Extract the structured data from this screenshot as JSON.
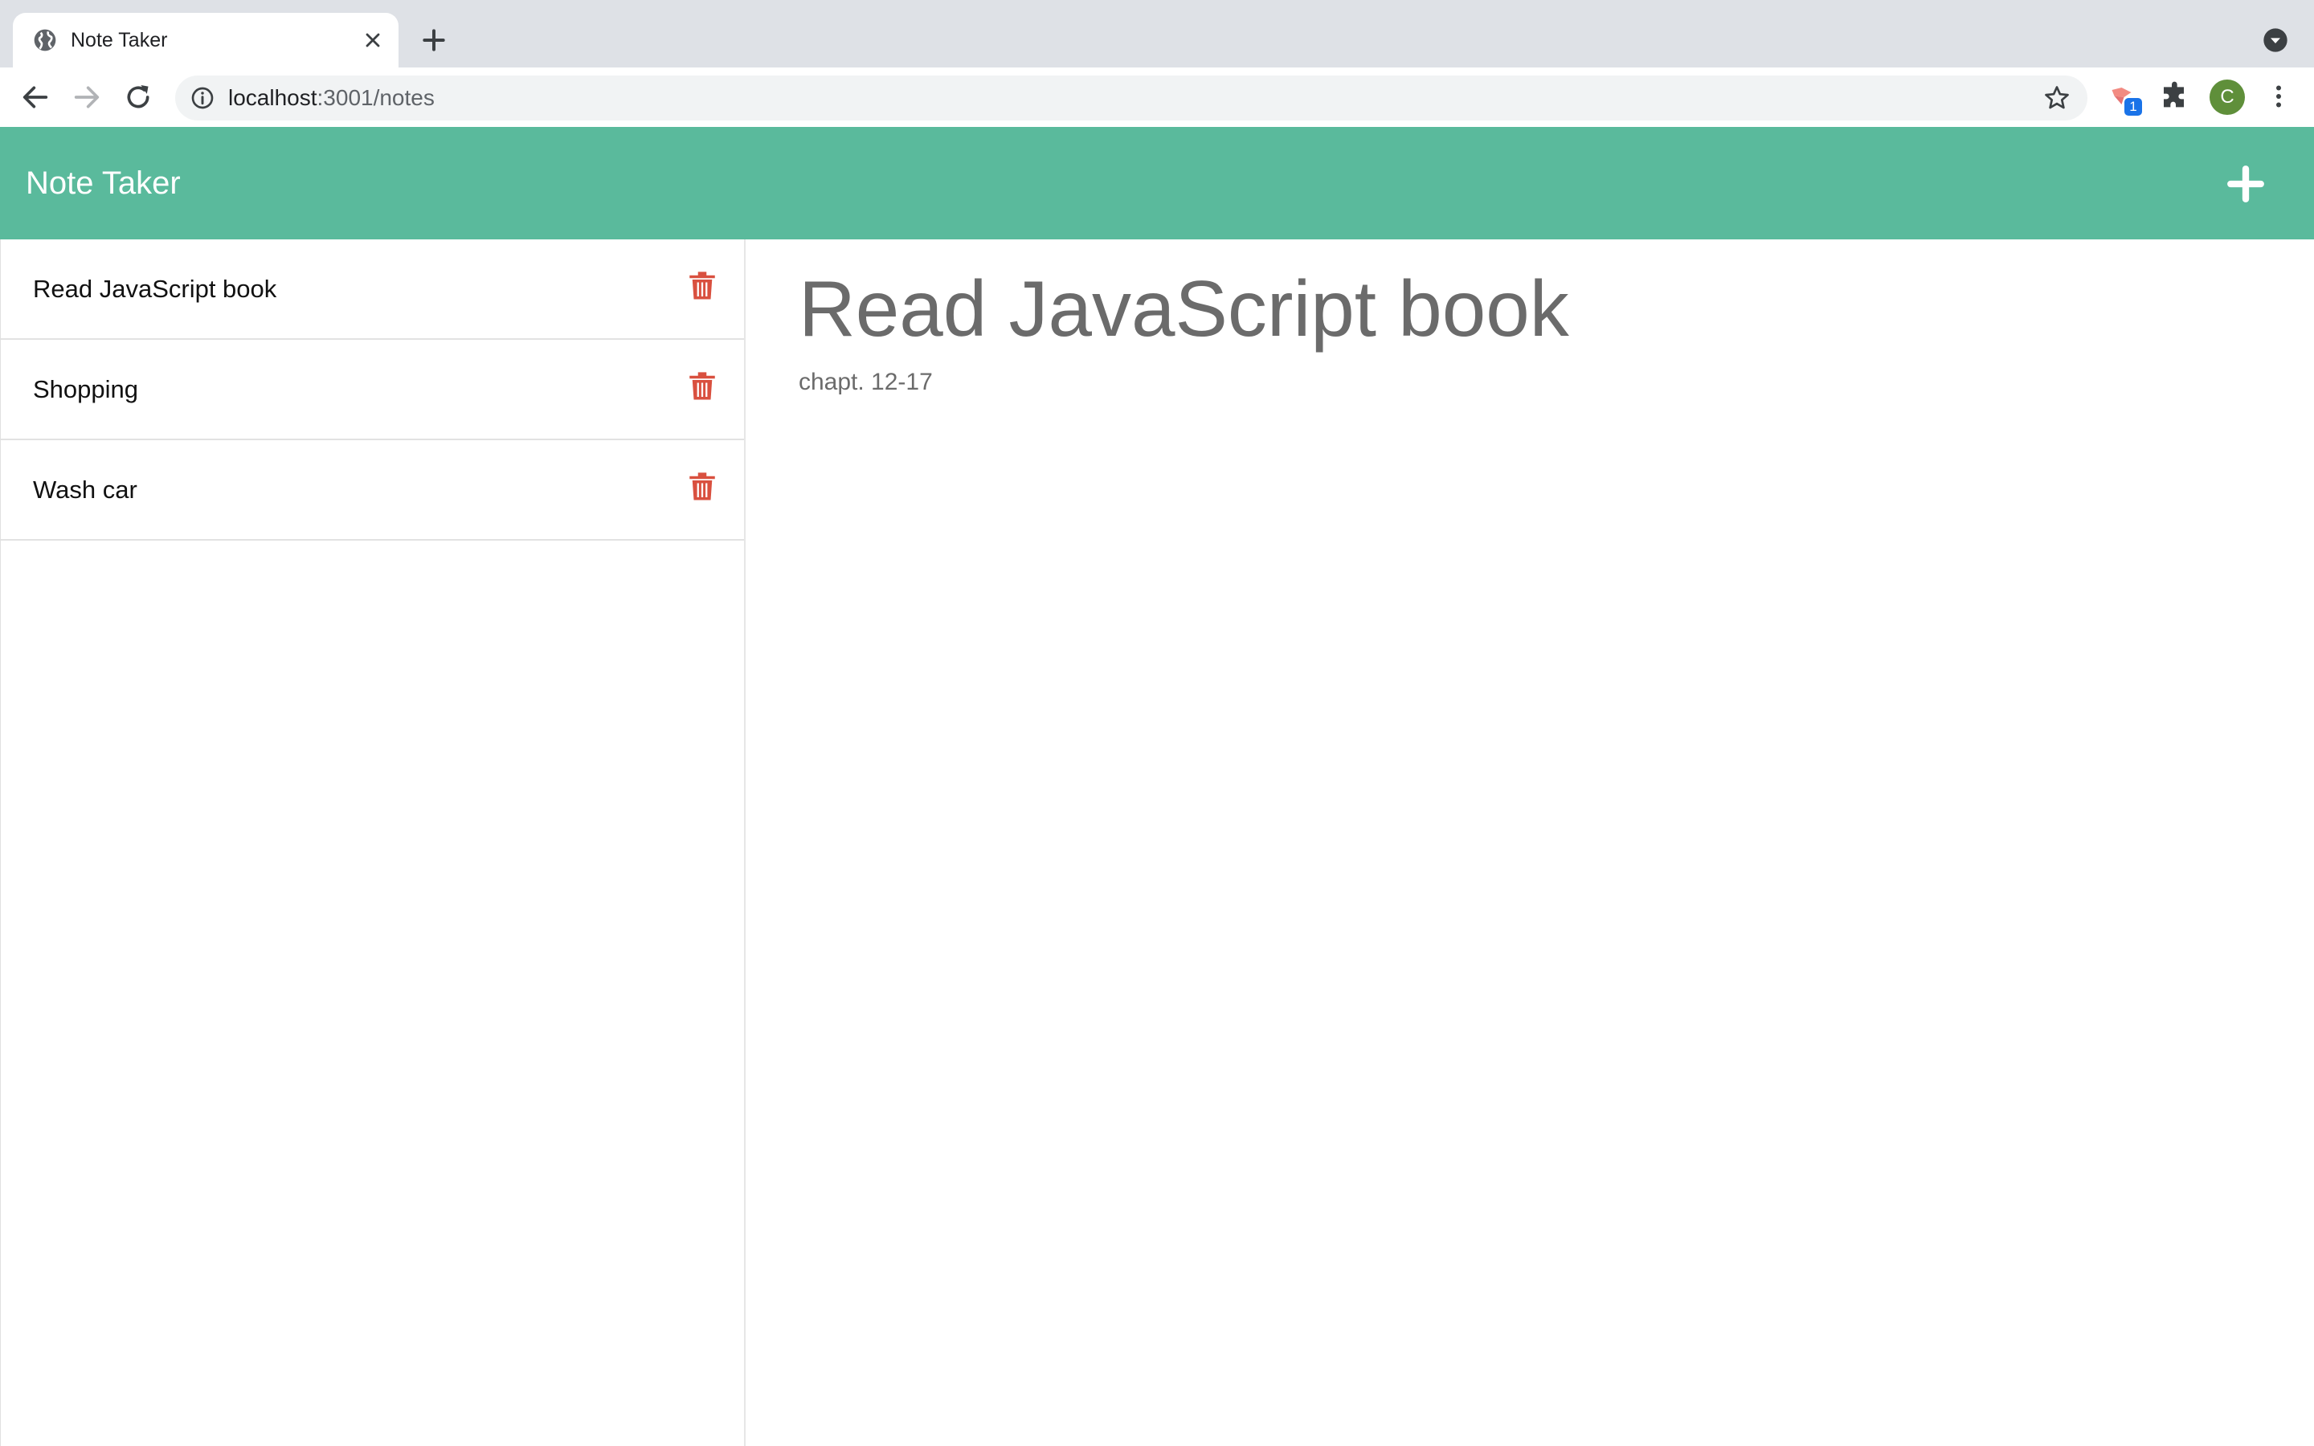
{
  "browser": {
    "tab_title": "Note Taker",
    "url_host": "localhost",
    "url_path": ":3001/notes",
    "extension_badge": "1",
    "profile_initial": "C"
  },
  "app": {
    "title": "Note Taker",
    "header_color": "#5aba9c",
    "new_note_icon": "plus-icon"
  },
  "notes": [
    {
      "title": "Read JavaScript book"
    },
    {
      "title": "Shopping"
    },
    {
      "title": "Wash car"
    }
  ],
  "active_note": {
    "title": "Read JavaScript book",
    "text": "chapt. 12-17"
  },
  "colors": {
    "delete_icon": "#d9503f",
    "note_text": "#6b6b6b"
  }
}
